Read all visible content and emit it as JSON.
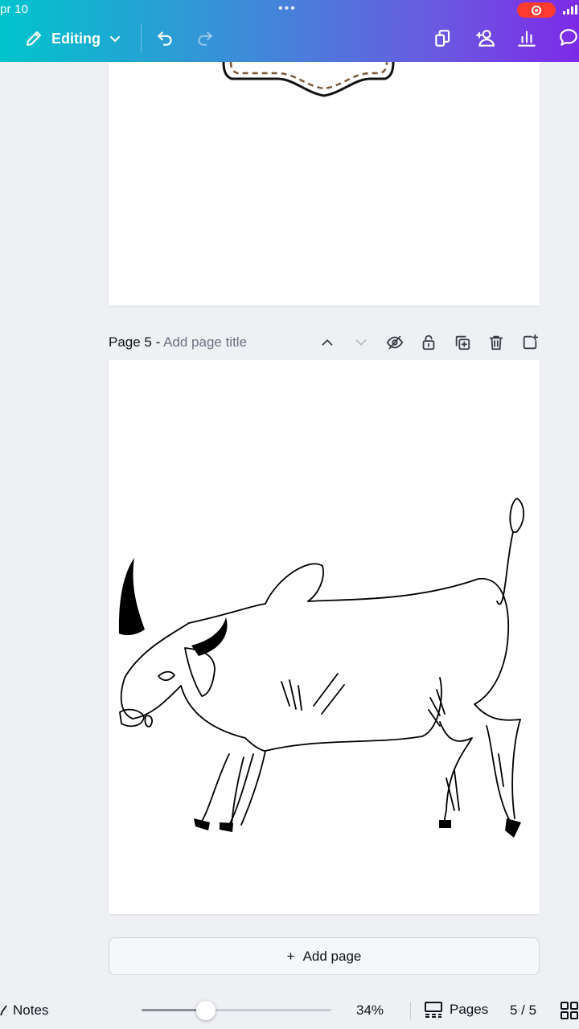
{
  "status": {
    "time": "pr 10",
    "dots": "•••"
  },
  "toolbar": {
    "mode_label": "Editing",
    "icons": [
      "pencil-icon",
      "chevron-down-icon",
      "undo-icon",
      "redo-icon",
      "pages-icon",
      "share-people-icon",
      "insights-icon",
      "comment-icon"
    ]
  },
  "canvas": {
    "page_number_label": "Page 5 -",
    "page_title_placeholder": "Add page title",
    "page_header_icons": [
      "chevron-up-icon",
      "chevron-down-icon",
      "hide-icon",
      "lock-icon",
      "duplicate-icon",
      "trash-icon",
      "add-page-icon"
    ],
    "add_page_label": "Add page",
    "add_page_plus": "+"
  },
  "bottombar": {
    "notes_label": "Notes",
    "zoom_value": "34%",
    "zoom_fraction": 0.34,
    "pages_label": "Pages",
    "page_count": "5 / 5"
  },
  "colors": {
    "gradient_start": "#00c4cc",
    "gradient_end": "#7d2ae8",
    "record": "#ff3b30"
  }
}
